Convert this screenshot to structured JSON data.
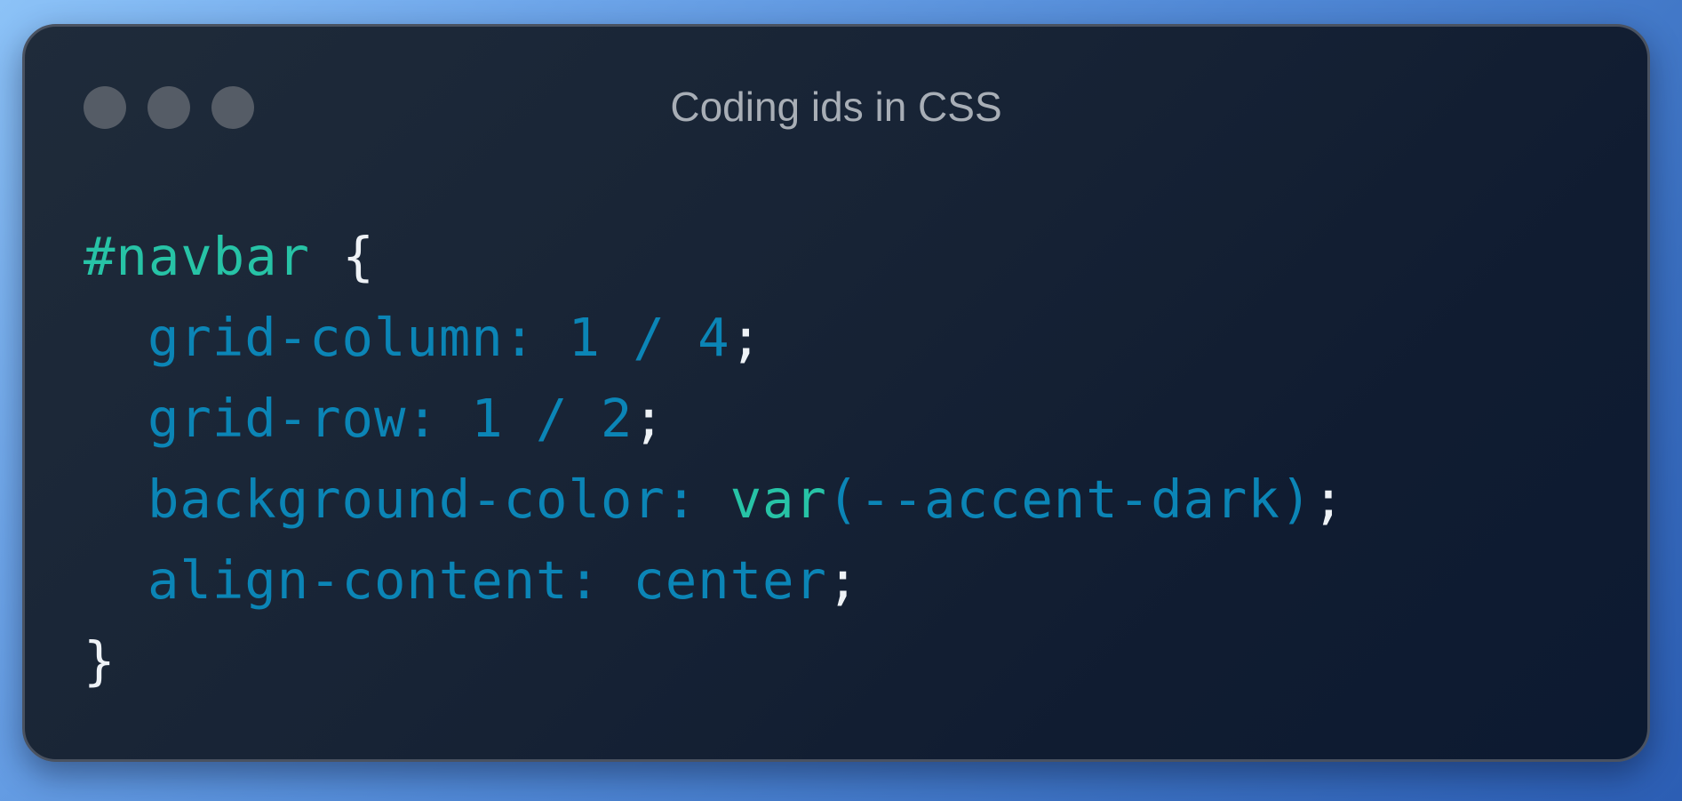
{
  "window": {
    "title": "Coding ids in CSS"
  },
  "colors": {
    "selector": "#27c3a6",
    "function": "#27c3a6",
    "property": "#0b85b6",
    "value": "#0b85b6",
    "punctuation": "#eef2f6",
    "title_text": "#a8aeb6",
    "window_dot": "#555c66"
  },
  "code": {
    "line1": {
      "selector": "#navbar",
      "brace": "{"
    },
    "line2": {
      "property": "grid-column",
      "colon": ":",
      "value": "1 / 4",
      "semicolon": ";"
    },
    "line3": {
      "property": "grid-row",
      "colon": ":",
      "value": "1 / 2",
      "semicolon": ";"
    },
    "line4": {
      "property": "background-color",
      "colon": ":",
      "function": "var",
      "paren_open": "(",
      "argument": "--accent-dark",
      "paren_close": ")",
      "semicolon": ";"
    },
    "line5": {
      "property": "align-content",
      "colon": ":",
      "value": "center",
      "semicolon": ";"
    },
    "line6": {
      "brace": "}"
    }
  }
}
